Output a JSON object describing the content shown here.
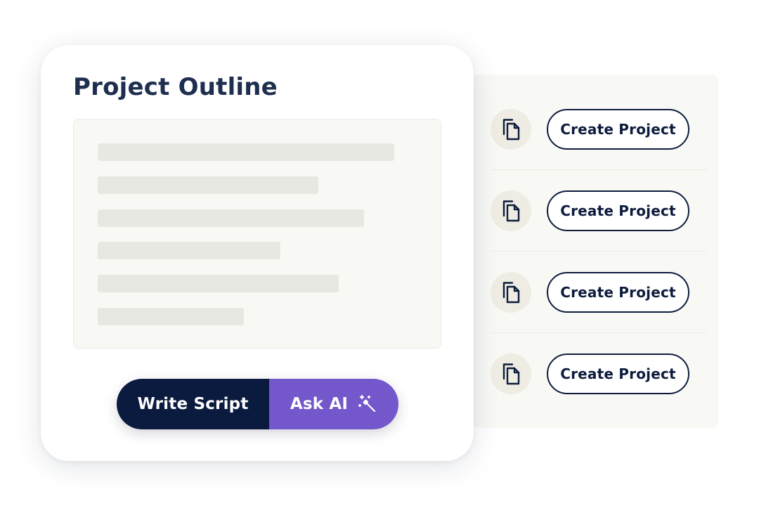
{
  "card": {
    "title": "Project Outline",
    "placeholder_lines": 6
  },
  "buttons": {
    "write_script": "Write Script",
    "ask_ai": "Ask AI"
  },
  "actions": [
    {
      "label": "Create Project",
      "icon": "document-copy-icon"
    },
    {
      "label": "Create Project",
      "icon": "document-copy-icon"
    },
    {
      "label": "Create Project",
      "icon": "document-copy-icon"
    },
    {
      "label": "Create Project",
      "icon": "document-copy-icon"
    }
  ],
  "colors": {
    "navy": "#0b1a3f",
    "purple": "#7457cb",
    "title": "#1e2e4f",
    "panel": "#f8f8f5",
    "placeholder": "#e8e8e3"
  },
  "icons": {
    "ask_ai": "magic-wand-icon"
  }
}
